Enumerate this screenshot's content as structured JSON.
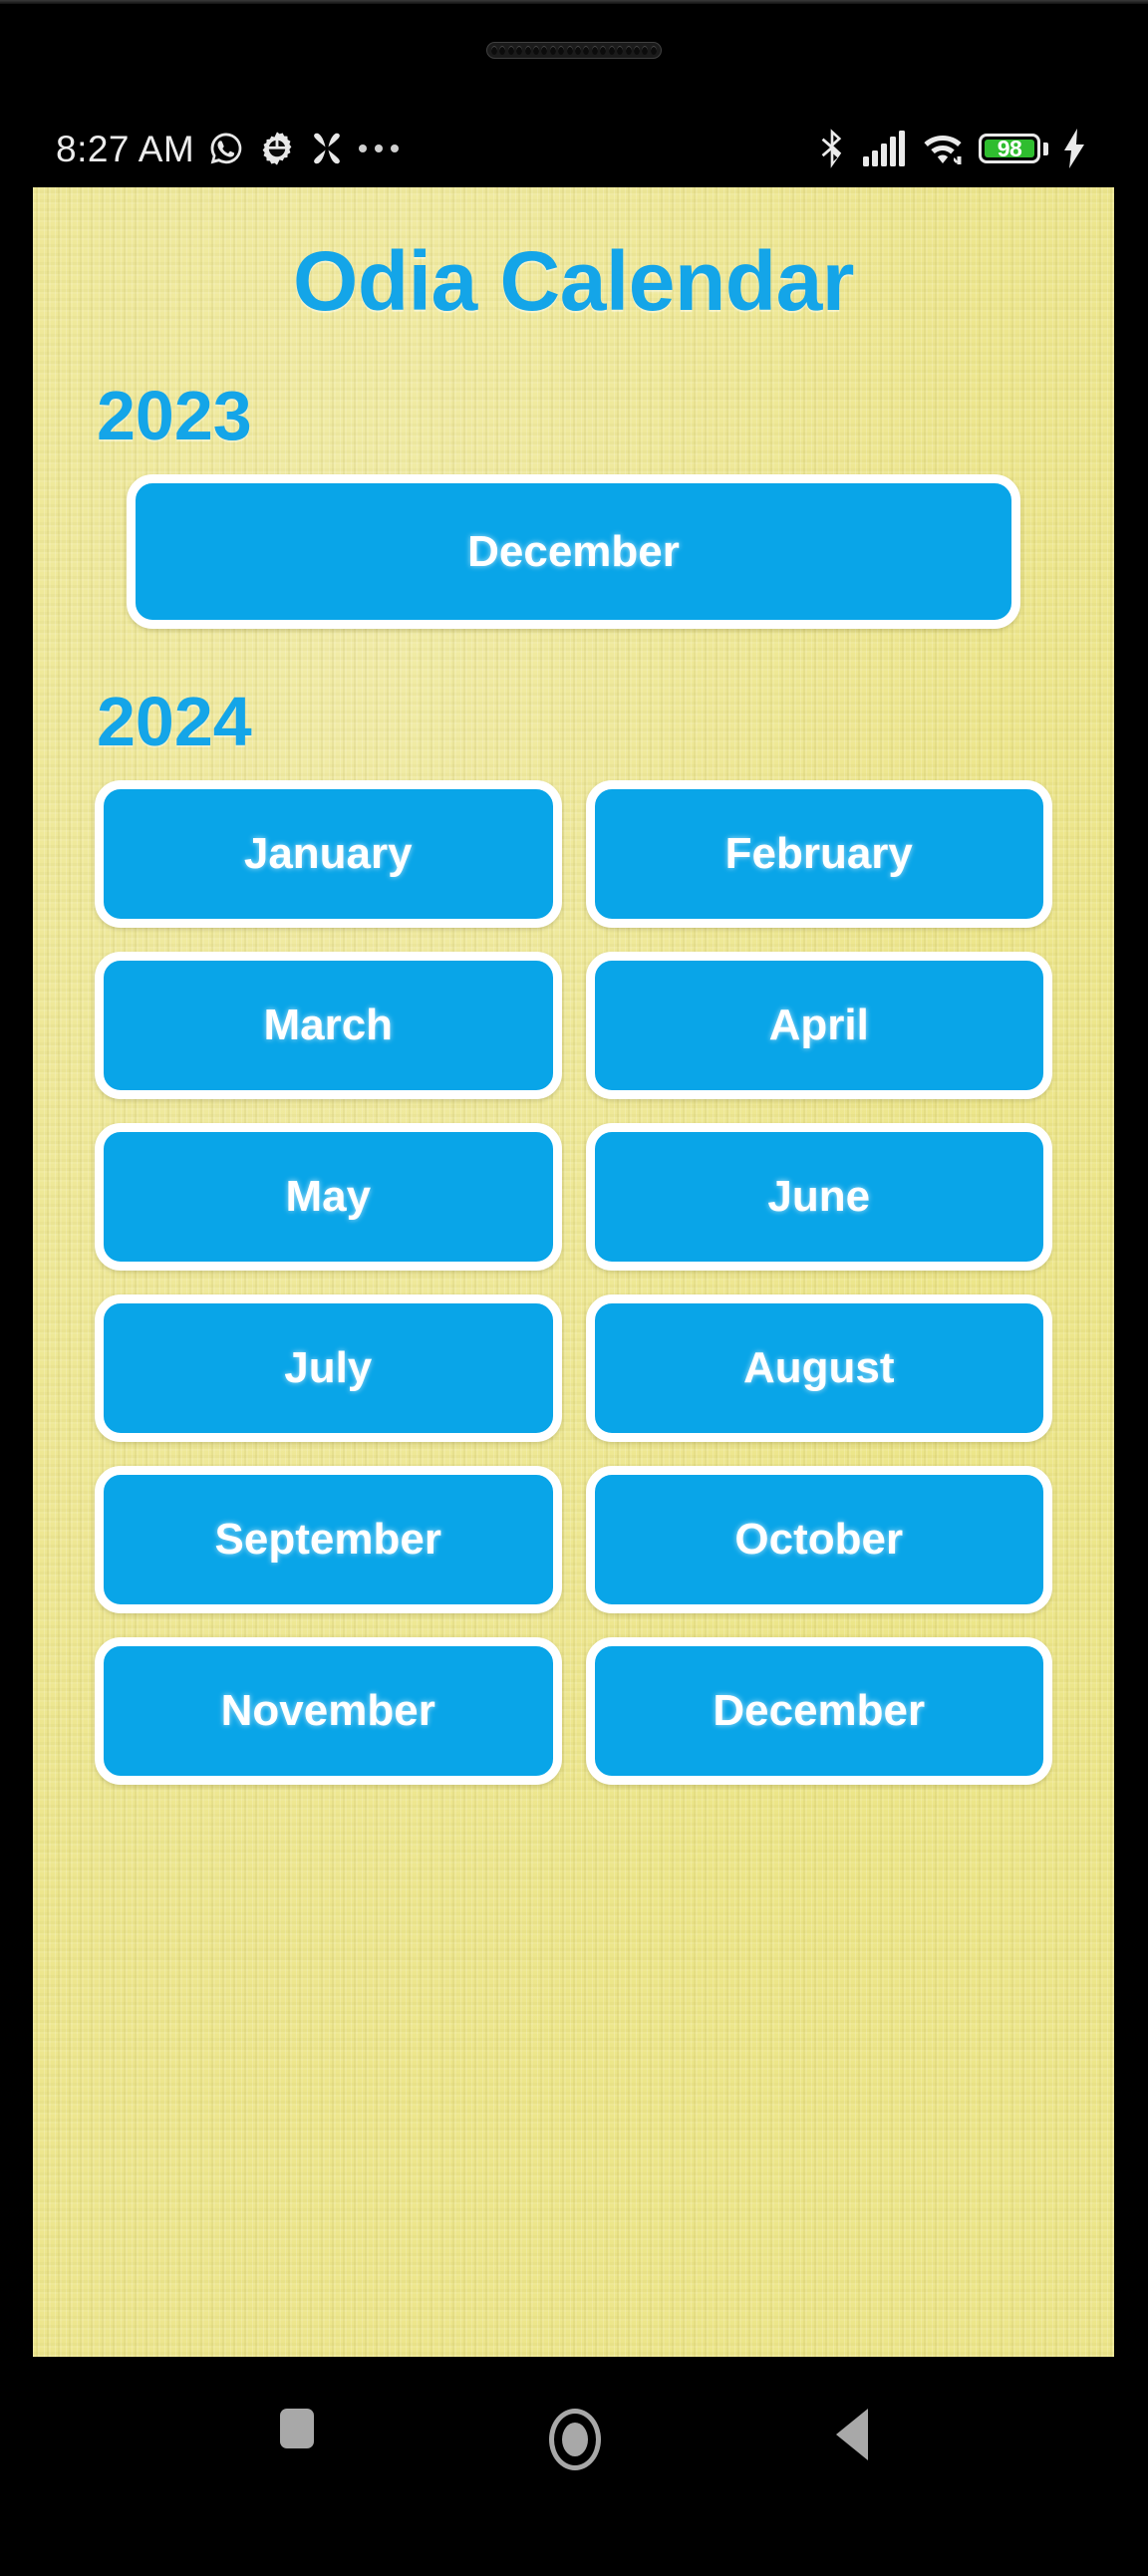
{
  "device": {
    "speaker_icon": "speaker-grille-icon",
    "statusbar": {
      "clock": "8:27 AM",
      "left_icons": [
        "whatsapp-icon",
        "gear-icon",
        "clover-icon",
        "more-dots-icon"
      ],
      "right_icons": [
        "bluetooth-icon",
        "cellular-signal-icon",
        "wifi-icon"
      ],
      "battery_percent": "98",
      "battery_color": "#2fbd2f",
      "charging_icon": "charging-bolt-icon"
    },
    "navbar": {
      "recents_label": "Recents",
      "home_label": "Home",
      "back_label": "Back",
      "icon_color": "#a8a8a8"
    }
  },
  "app": {
    "title": "Odia Calendar",
    "accent_color": "#14a5e8",
    "button_color": "#09a5e8",
    "background_color": "#ede68e",
    "sections": [
      {
        "year": "2023",
        "rows": [
          [
            "December"
          ]
        ]
      },
      {
        "year": "2024",
        "rows": [
          [
            "January",
            "February"
          ],
          [
            "March",
            "April"
          ],
          [
            "May",
            "June"
          ],
          [
            "July",
            "August"
          ],
          [
            "September",
            "October"
          ],
          [
            "November",
            "December"
          ]
        ]
      }
    ]
  }
}
